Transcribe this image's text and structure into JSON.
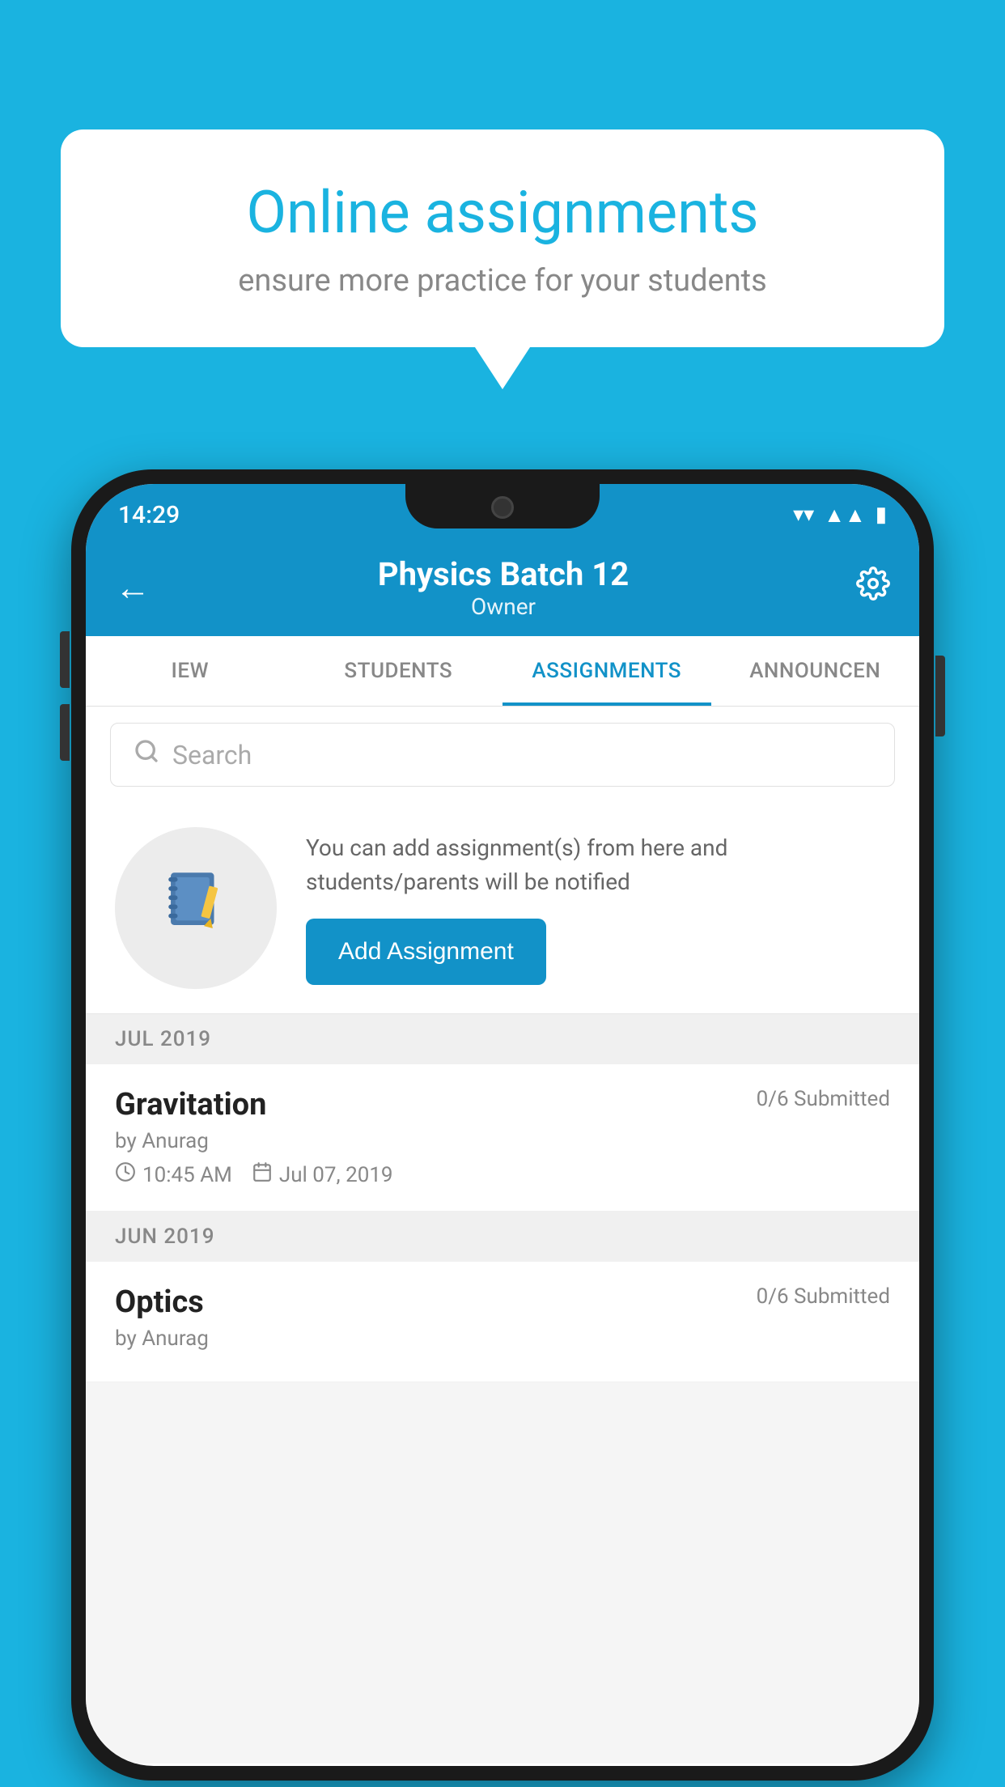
{
  "background_color": "#1ab3e0",
  "speech_bubble": {
    "title": "Online assignments",
    "subtitle": "ensure more practice for your students"
  },
  "phone": {
    "status_bar": {
      "time": "14:29"
    },
    "header": {
      "title": "Physics Batch 12",
      "subtitle": "Owner",
      "back_icon": "←",
      "settings_icon": "⚙"
    },
    "tabs": [
      {
        "label": "IEW",
        "active": false
      },
      {
        "label": "STUDENTS",
        "active": false
      },
      {
        "label": "ASSIGNMENTS",
        "active": true
      },
      {
        "label": "ANNOUNCEN",
        "active": false
      }
    ],
    "search": {
      "placeholder": "Search"
    },
    "promo": {
      "text": "You can add assignment(s) from here and students/parents will be notified",
      "button_label": "Add Assignment"
    },
    "sections": [
      {
        "header": "JUL 2019",
        "assignments": [
          {
            "title": "Gravitation",
            "submitted": "0/6 Submitted",
            "author": "by Anurag",
            "time": "10:45 AM",
            "date": "Jul 07, 2019"
          }
        ]
      },
      {
        "header": "JUN 2019",
        "assignments": [
          {
            "title": "Optics",
            "submitted": "0/6 Submitted",
            "author": "by Anurag",
            "time": "",
            "date": ""
          }
        ]
      }
    ]
  }
}
